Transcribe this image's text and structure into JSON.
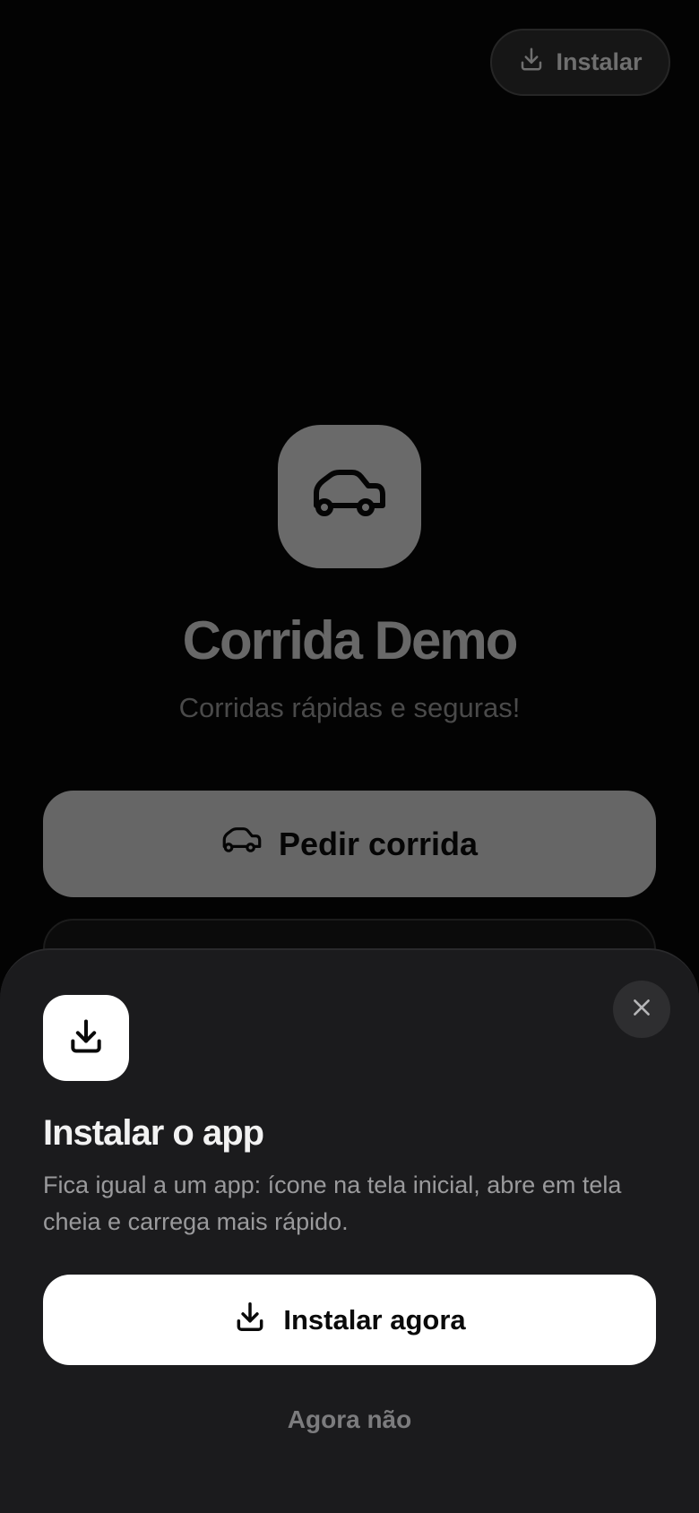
{
  "header": {
    "install_label": "Instalar"
  },
  "hero": {
    "app_icon": "car-icon",
    "title": "Corrida Demo",
    "subtitle": "Corridas rápidas e seguras!"
  },
  "actions": {
    "request_ride_label": "Pedir corrida"
  },
  "install_sheet": {
    "icon": "download-icon",
    "title": "Instalar o app",
    "description": "Fica igual a um app: ícone na tela inicial, abre em tela cheia e carrega mais rápido.",
    "install_now_label": "Instalar agora",
    "not_now_label": "Agora não"
  },
  "colors": {
    "background": "#030303",
    "sheet_background": "#1b1b1d",
    "primary_button": "#666666",
    "install_button": "#ffffff"
  }
}
